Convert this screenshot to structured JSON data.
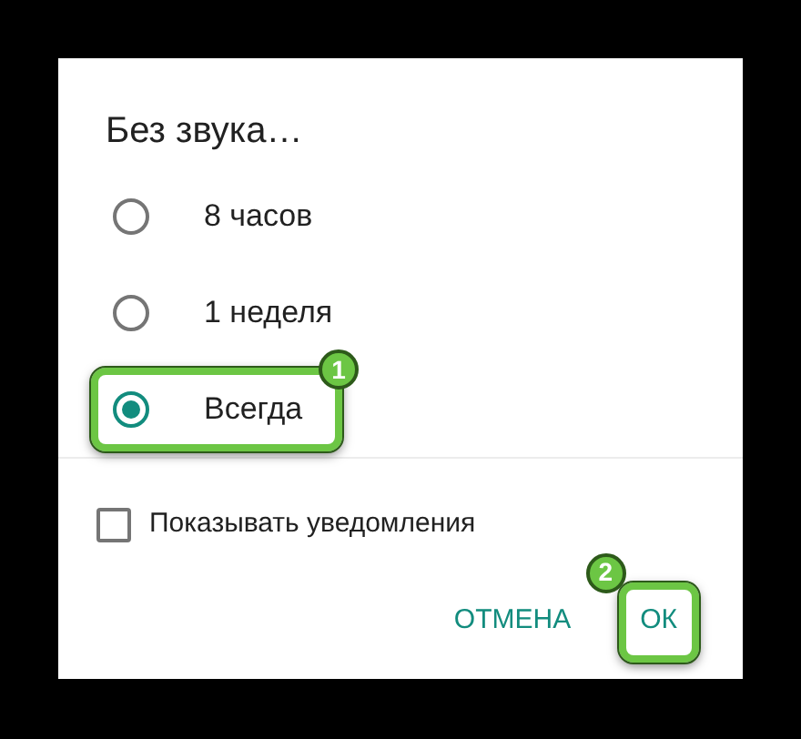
{
  "dialog": {
    "title": "Без звука…",
    "options": [
      {
        "label": "8 часов",
        "selected": false
      },
      {
        "label": "1 неделя",
        "selected": false
      },
      {
        "label": "Всегда",
        "selected": true,
        "callout": "1"
      }
    ],
    "checkbox": {
      "label": "Показывать уведомления",
      "checked": false
    },
    "buttons": [
      {
        "label": "ОТМЕНА"
      },
      {
        "label": "ОК",
        "callout": "2"
      }
    ]
  }
}
